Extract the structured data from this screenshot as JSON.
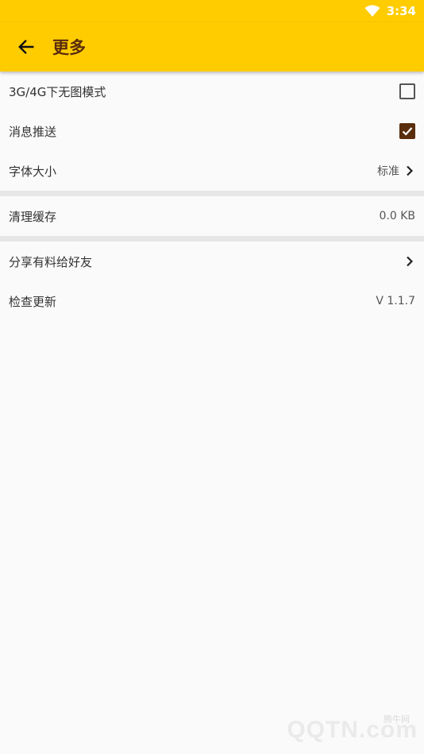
{
  "status_bar": {
    "time": "3:34"
  },
  "app_bar": {
    "title": "更多",
    "back_icon": "arrow-left-icon"
  },
  "sections": [
    {
      "items": [
        {
          "label": "3G/4G下无图模式",
          "control": "checkbox",
          "checked": false
        },
        {
          "label": "消息推送",
          "control": "checkbox",
          "checked": true
        },
        {
          "label": "字体大小",
          "control": "value-chevron",
          "value": "标准"
        }
      ]
    },
    {
      "items": [
        {
          "label": "清理缓存",
          "control": "value",
          "value": "0.0 KB"
        }
      ]
    },
    {
      "items": [
        {
          "label": "分享有料给好友",
          "control": "chevron"
        },
        {
          "label": "检查更新",
          "control": "value",
          "value": "V 1.1.7"
        }
      ]
    }
  ],
  "watermark": {
    "text": "QQTN.com",
    "small": "腾牛网"
  },
  "colors": {
    "accent": "#ffcc00",
    "title": "#5a2d0c",
    "checkbox_checked": "#5a2d0c",
    "divider": "#e6e6e6"
  }
}
